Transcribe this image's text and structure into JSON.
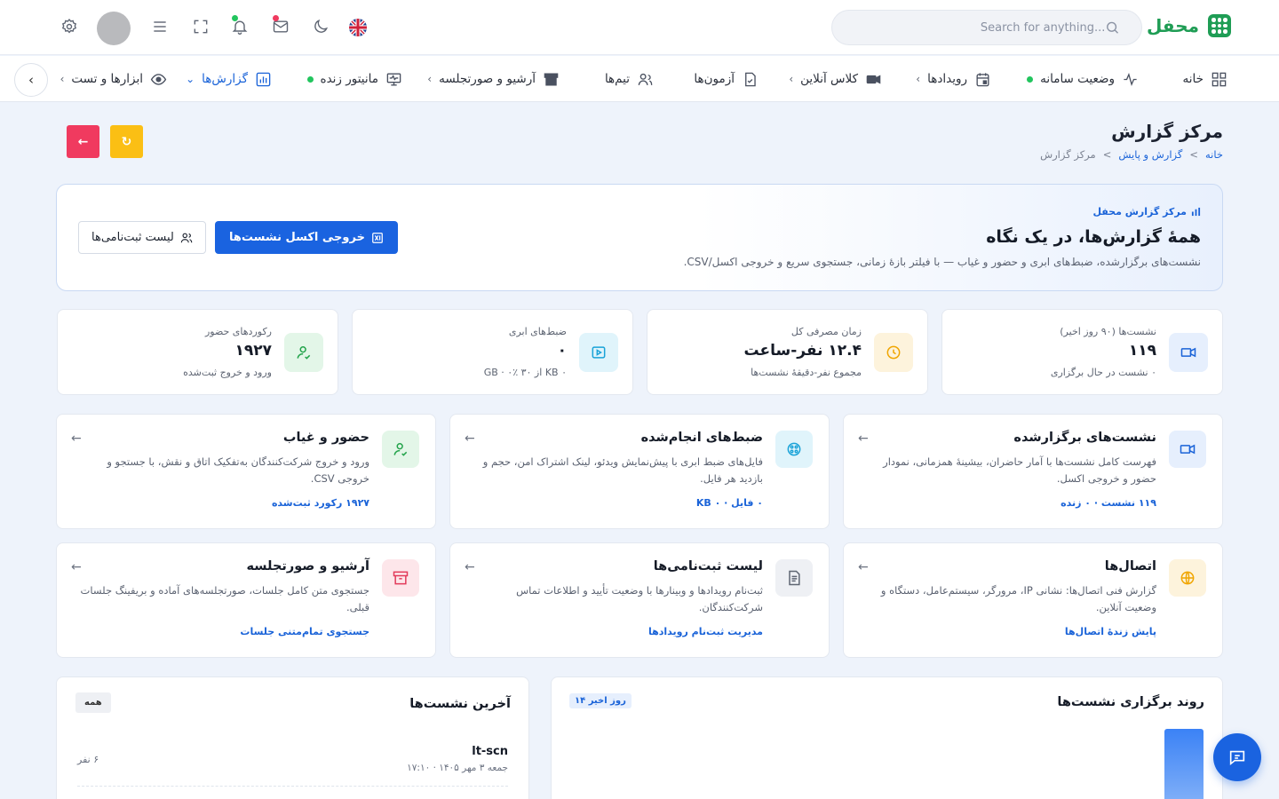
{
  "brand": {
    "name": "محفل"
  },
  "search": {
    "placeholder": "Search for anything..."
  },
  "nav": {
    "home": "خانه",
    "system_status": "وضعیت سامانه",
    "events": "رویدادها",
    "online_class": "کلاس آنلاین",
    "exams": "آزمون‌ها",
    "teams": "تیم‌ها",
    "archive": "آرشیو و صورتجلسه",
    "live_monitor": "مانیتور زنده",
    "reports": "گزارش‌ها",
    "tools": "ابزارها و تست"
  },
  "page": {
    "title": "مرکز گزارش",
    "breadcrumb": [
      "خانه",
      "گزارش و پایش",
      "مرکز گزارش"
    ]
  },
  "hero": {
    "eyebrow": "مرکز گزارش محفل",
    "title": "همهٔ گزارش‌ها، در یک نگاه",
    "description": "نشست‌های برگزارشده، ضبط‌های ابری و حضور و غیاب — با فیلتر بازهٔ زمانی، جستجوی سریع و خروجی اکسل/CSV.",
    "export_button": "خروجی اکسل نشست‌ها",
    "registrations_button": "لیست ثبت‌نامی‌ها"
  },
  "stats": [
    {
      "label": "نشست‌ها (۹۰ روز اخیر)",
      "value": "۱۱۹",
      "sub": "۰ نشست در حال برگزاری",
      "icon": "video-icon"
    },
    {
      "label": "زمان مصرفی کل",
      "value": "۱۲.۴ نفر-ساعت",
      "sub": "مجموع نفر-دقیقهٔ نشست‌ها",
      "icon": "clock-icon"
    },
    {
      "label": "ضبط‌های ابری",
      "value": "۰",
      "sub": "۰ KB از ۳۰ ٪۰ · GB",
      "icon": "play-icon"
    },
    {
      "label": "رکوردهای حضور",
      "value": "۱۹۲۷",
      "sub": "ورود و خروج ثبت‌شده",
      "icon": "user-check-icon"
    }
  ],
  "cards": [
    {
      "title": "نشست‌های برگزارشده",
      "description": "فهرست کامل نشست‌ها با آمار حاضران، بیشینهٔ همزمانی، نمودار حضور و خروجی اکسل.",
      "link": "۱۱۹ نشست · ۰ زنده"
    },
    {
      "title": "ضبط‌های انجام‌شده",
      "description": "فایل‌های ضبط ابری با پیش‌نمایش ویدئو، لینک اشتراک امن، حجم و بازدید هر فایل.",
      "link": "۰ فایل · ۰ KB"
    },
    {
      "title": "حضور و غیاب",
      "description": "ورود و خروج شرکت‌کنندگان به‌تفکیک اتاق و نقش، با جستجو و خروجی CSV.",
      "link": "۱۹۲۷ رکورد ثبت‌شده"
    },
    {
      "title": "اتصال‌ها",
      "description": "گزارش فنی اتصال‌ها: نشانی IP، مرورگر، سیستم‌عامل، دستگاه و وضعیت آنلاین.",
      "link": "پایش زندهٔ اتصال‌ها"
    },
    {
      "title": "لیست ثبت‌نامی‌ها",
      "description": "ثبت‌نام رویدادها و وبینارها با وضعیت تأیید و اطلاعات تماس شرکت‌کنندگان.",
      "link": "مدیریت ثبت‌نام رویدادها"
    },
    {
      "title": "آرشیو و صورتجلسه",
      "description": "جستجوی متن کامل جلسات، صورتجلسه‌های آماده و بریفینگ جلسات قبلی.",
      "link": "جستجوی تمام‌متنی جلسات"
    }
  ],
  "trend_panel": {
    "title": "روند برگزاری نشست‌ها",
    "badge": "۱۴ روز اخیر"
  },
  "sessions_panel": {
    "title": "آخرین نشست‌ها",
    "badge": "همه",
    "items": [
      {
        "name": "lt-scn",
        "meta": "جمعه ۳ مهر ۱۴۰۵ · ۱۷:۱۰",
        "count": "۶ نفر"
      }
    ]
  },
  "colors": {
    "accent": "#1a63e0",
    "brand": "#1f9d55",
    "danger": "#f03a5f",
    "warning": "#fbbf14"
  }
}
